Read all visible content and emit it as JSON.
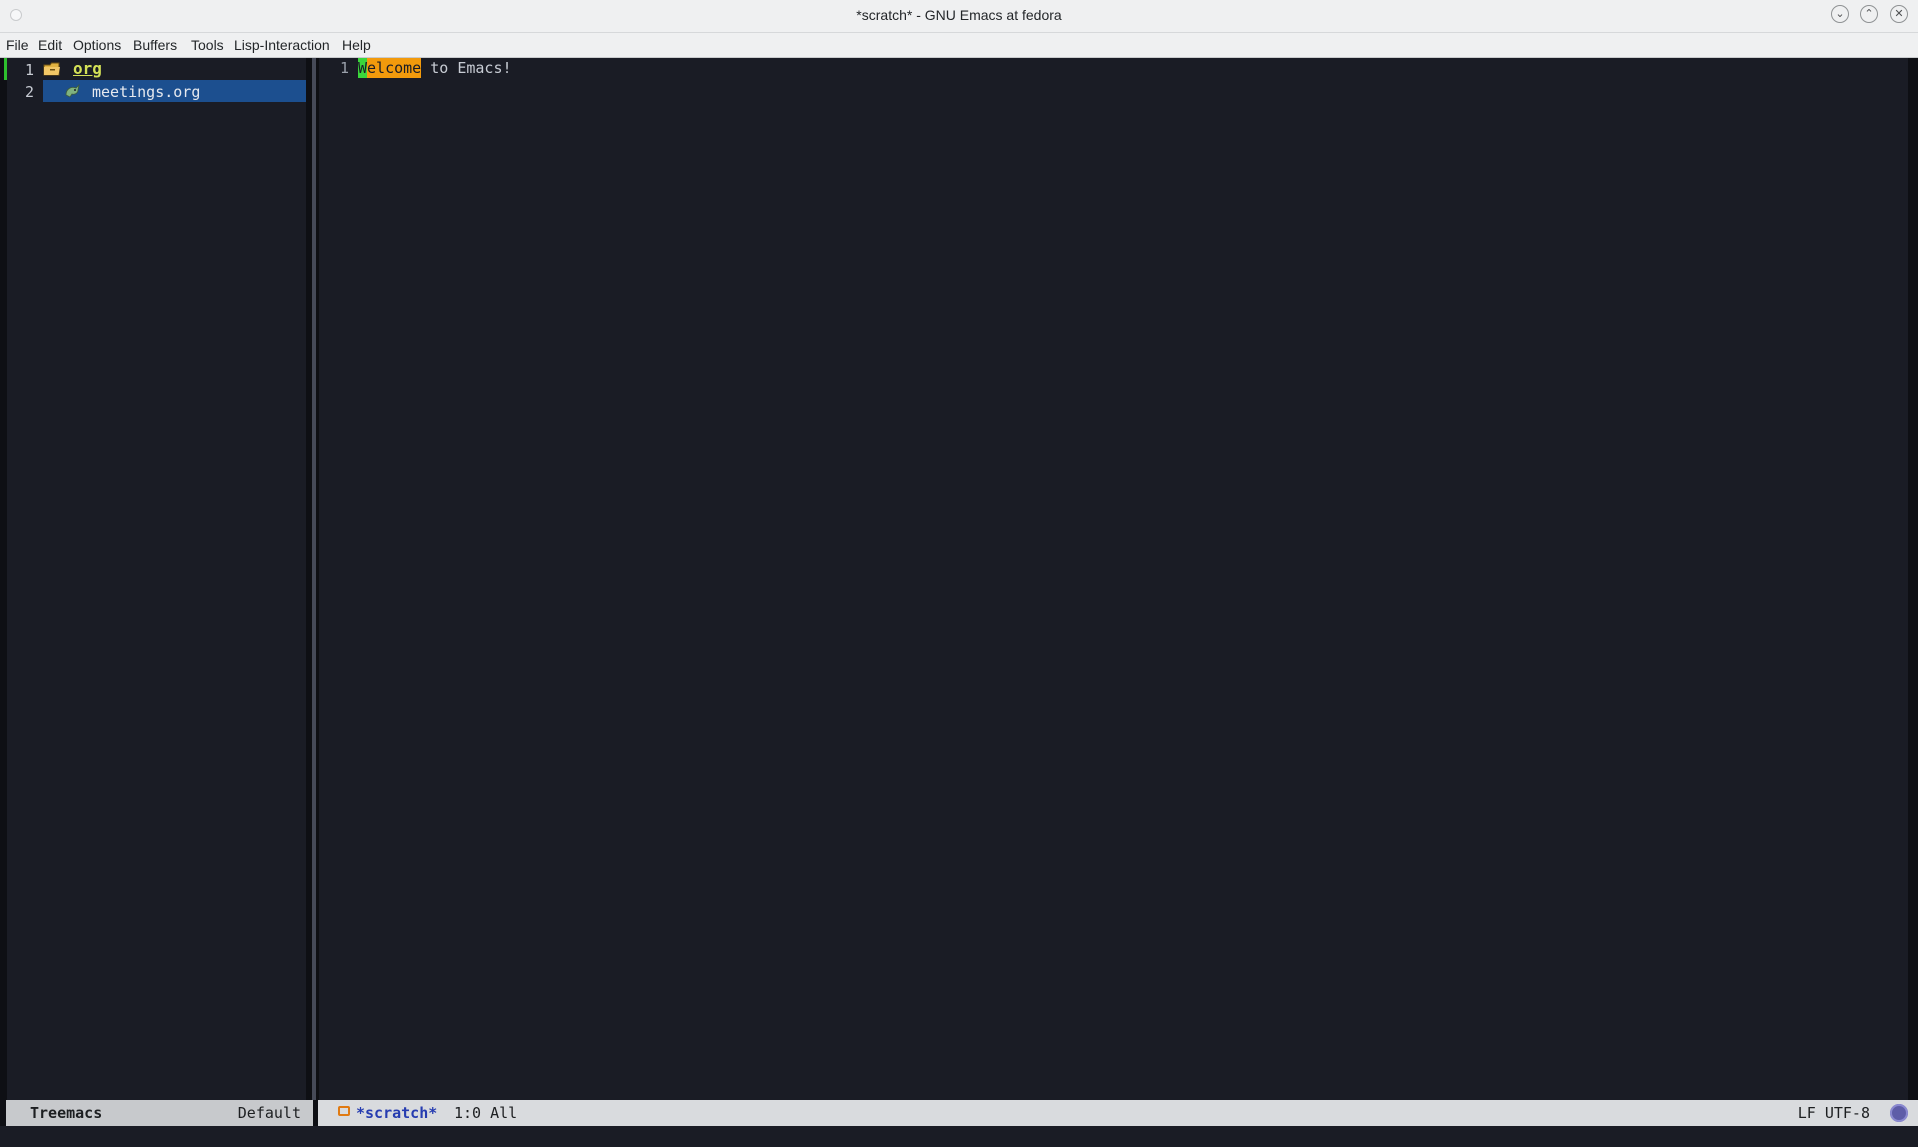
{
  "window": {
    "title": "*scratch* - GNU Emacs at fedora",
    "minimize_glyph": "⌄",
    "maximize_glyph": "⌃",
    "close_glyph": "✕"
  },
  "menubar": {
    "items": [
      "File",
      "Edit",
      "Options",
      "Buffers",
      "Tools",
      "Lisp-Interaction",
      "Help"
    ]
  },
  "treemacs": {
    "lines": [
      {
        "number": "1",
        "name": "org",
        "icon": "folder-icon"
      },
      {
        "number": "2",
        "name": "meetings.org",
        "icon": "org-unicorn-icon",
        "selected": true
      }
    ],
    "modeline": {
      "name": "Treemacs",
      "workspace": "Default"
    }
  },
  "editor": {
    "lines": [
      {
        "number": "1",
        "cursor_char": "W",
        "highlighted_word": "elcome",
        "rest": " to Emacs!"
      }
    ],
    "modeline": {
      "buffer_name": "*scratch*",
      "position": "1:0 All",
      "encoding": "LF UTF-8",
      "buffer_icon": "buffer-icon",
      "mode_icon": "emacs-icon"
    }
  },
  "colors": {
    "background": "#1a1c25",
    "selection": "#1c4f8f",
    "cursor": "#3bd63b",
    "highlight": "#f29a0c",
    "treemacs_root": "#d4e157",
    "modeline_buffer_name": "#263cb0"
  }
}
